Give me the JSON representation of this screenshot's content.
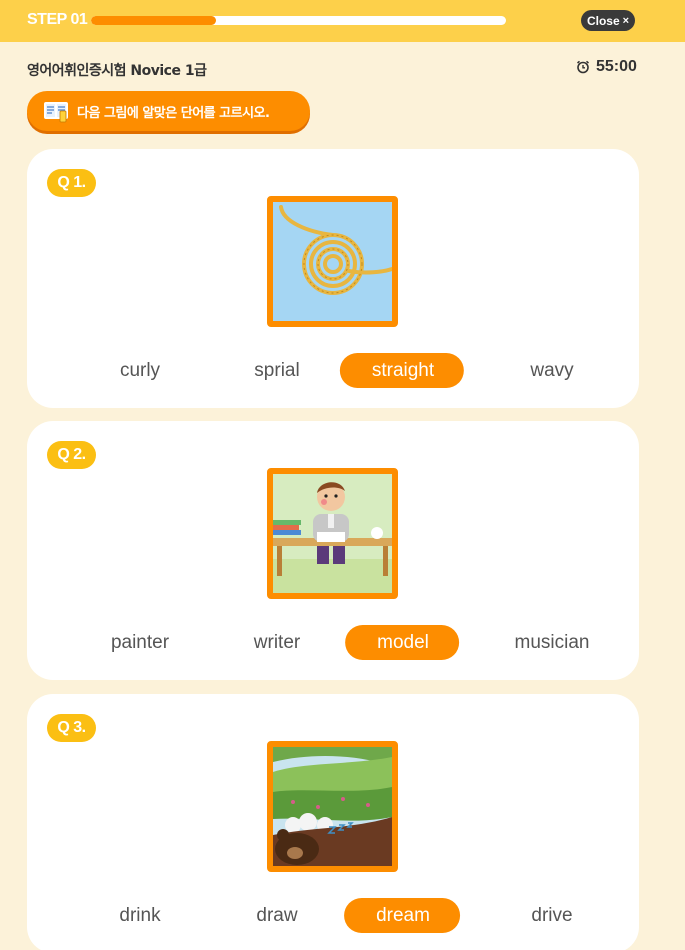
{
  "topbar": {
    "step_label": "STEP 01",
    "progress_fraction": 0.3,
    "close_label": "Close",
    "close_symbol": "×"
  },
  "header": {
    "exam_title": "영어어휘인증시험 Novice 1급",
    "timer": "55:00",
    "timer_icon": "alarm-clock-icon"
  },
  "instruction": {
    "text": "다음 그림에 알맞은 단어를 고르시오.",
    "icon": "book-icon"
  },
  "questions": [
    {
      "badge": "Q 1.",
      "image": "rope-coil-image",
      "choices": [
        "curly",
        "sprial",
        "straight",
        "wavy"
      ],
      "selected": 2
    },
    {
      "badge": "Q 2.",
      "image": "man-writing-at-desk-image",
      "choices": [
        "painter",
        "writer",
        "model",
        "musician"
      ],
      "selected": 2
    },
    {
      "badge": "Q 3.",
      "image": "sleeping-bear-dream-image",
      "choices": [
        "drink",
        "draw",
        "dream",
        "drive"
      ],
      "selected": 2
    }
  ],
  "colors": {
    "topbar": "#fdd04a",
    "accent": "#fd8d00",
    "badge": "#fbbf13",
    "background": "#fcf2d9"
  }
}
